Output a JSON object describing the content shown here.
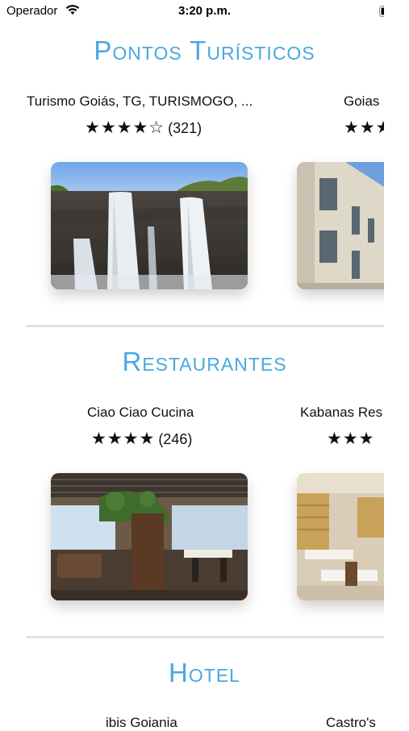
{
  "status_bar": {
    "carrier": "Operador",
    "time": "3:20 p.m."
  },
  "sections": [
    {
      "title": "Pontos Turísticos",
      "cards": [
        {
          "name": "Turismo Goiás, TG, TURISMOGO, ...",
          "stars": "★★★★☆",
          "count": "(321)"
        },
        {
          "name": "Goias",
          "stars": "★★★",
          "count": ""
        }
      ]
    },
    {
      "title": "Restaurantes",
      "cards": [
        {
          "name": "Ciao Ciao Cucina",
          "stars": "★★★★",
          "count": "(246)"
        },
        {
          "name": "Kabanas Res",
          "stars": "★★★",
          "count": ""
        }
      ]
    },
    {
      "title": "Hotel",
      "cards": [
        {
          "name": "ibis Goiania",
          "stars": "",
          "count": ""
        },
        {
          "name": "Castro's",
          "stars": "",
          "count": ""
        }
      ]
    }
  ],
  "icons": {
    "wifi": "wifi-icon",
    "battery": "battery-icon"
  },
  "colors": {
    "title": "#4aa8e0",
    "divider": "#e6e2da"
  }
}
